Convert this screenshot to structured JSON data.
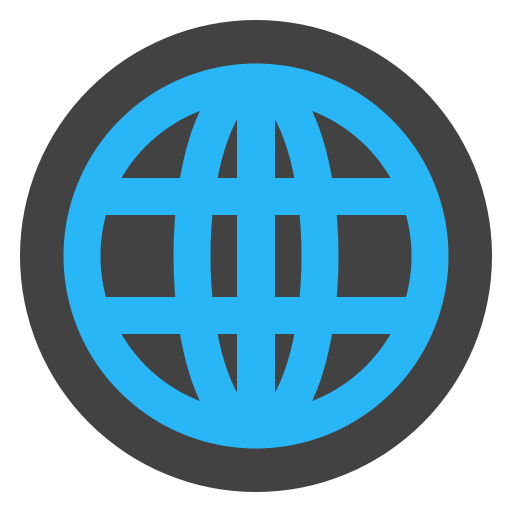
{
  "app_icon": {
    "name": "globe-icon",
    "colors": {
      "background_circle": "#424242",
      "globe": "#29B6F6",
      "page_background": "#FFFFFF"
    }
  }
}
